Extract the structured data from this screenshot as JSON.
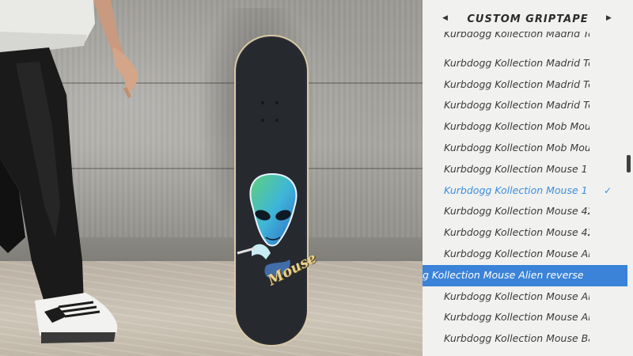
{
  "menu": {
    "title": "CUSTOM GRIPTAPE",
    "items": [
      {
        "label": "Kurbdogg Kollection Madrid Tc"
      },
      {
        "label": "Kurbdogg Kollection Madrid Tc"
      },
      {
        "label": "Kurbdogg Kollection Madrid Tc"
      },
      {
        "label": "Kurbdogg Kollection Madrid Tc"
      },
      {
        "label": "Kurbdogg Kollection Mob Mous"
      },
      {
        "label": "Kurbdogg Kollection Mob Mous"
      },
      {
        "label": "Kurbdogg Kollection Mouse 1 U"
      },
      {
        "label": "Kurbdogg Kollection Mouse 1 U",
        "equipped": true
      },
      {
        "label": "Kurbdogg Kollection Mouse 42"
      },
      {
        "label": "Kurbdogg Kollection Mouse 42"
      },
      {
        "label": "Kurbdogg Kollection Mouse Ali"
      },
      {
        "label": "g Kollection Mouse Alien reverse",
        "highlighted": true
      },
      {
        "label": "Kurbdogg Kollection Mouse All"
      },
      {
        "label": "Kurbdogg Kollection Mouse All"
      },
      {
        "label": "Kurbdogg Kollection Mouse Ba"
      }
    ]
  },
  "deck_graphic_text": "Mouse",
  "colors": {
    "highlight": "#3a83d9",
    "equipped_text": "#3a8ee0",
    "panel_bg": "#f1f1ef",
    "griptape": "#26292e"
  },
  "icons": {
    "prev": "caret-left-icon",
    "next": "caret-right-icon",
    "equipped": "checkmark-icon"
  }
}
